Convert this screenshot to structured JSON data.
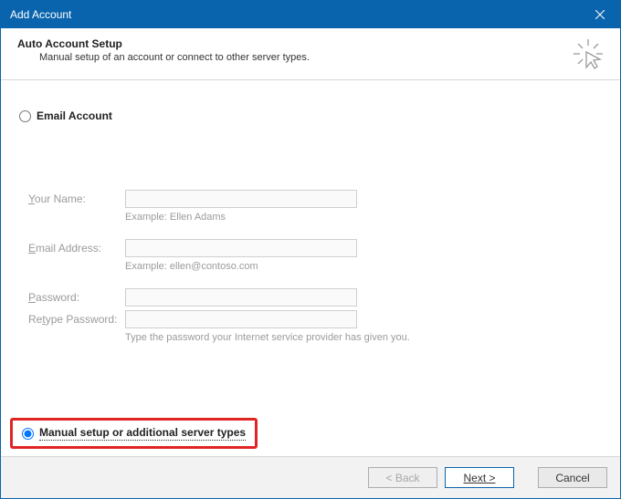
{
  "window": {
    "title": "Add Account"
  },
  "header": {
    "title": "Auto Account Setup",
    "subtitle": "Manual setup of an account or connect to other server types."
  },
  "options": {
    "email_label": "Email Account",
    "manual_label": "Manual setup or additional server types",
    "selected": "manual"
  },
  "form": {
    "name_label_pre": "Y",
    "name_label_post": "our Name:",
    "name_hint": "Example: Ellen Adams",
    "email_label_pre": "E",
    "email_label_post": "mail Address:",
    "email_hint": "Example: ellen@contoso.com",
    "password_pre": "P",
    "password_post": "assword:",
    "retype_pre": "Re",
    "retype_mid": "t",
    "retype_post": "ype Password:",
    "password_hint": "Type the password your Internet service provider has given you."
  },
  "buttons": {
    "back": "< Back",
    "next": "Next >",
    "cancel": "Cancel"
  }
}
